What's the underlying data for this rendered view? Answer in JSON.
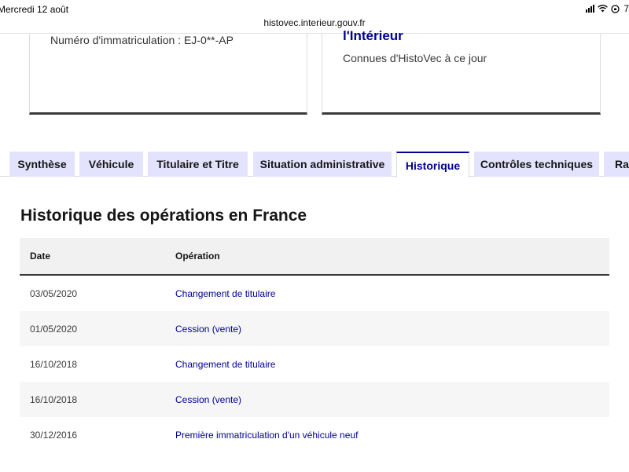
{
  "statusbar": {
    "time": "Mercredi 12 août",
    "battery": "7"
  },
  "browser": {
    "url": "histovec.interieur.gouv.fr"
  },
  "cards": {
    "left": {
      "plate_label": "Numéro d'immatriculation : EJ-0**-AP"
    },
    "right": {
      "title": "l'Intérieur",
      "subtitle": "Connues d'HistoVec à ce jour"
    }
  },
  "tabs": [
    {
      "label": "Synthèse"
    },
    {
      "label": "Véhicule"
    },
    {
      "label": "Titulaire et Titre"
    },
    {
      "label": "Situation administrative"
    },
    {
      "label": "Historique"
    },
    {
      "label": "Contrôles techniques"
    },
    {
      "label": "Rap"
    }
  ],
  "active_tab": "Historique",
  "history": {
    "title": "Historique des opérations en France",
    "columns": {
      "date": "Date",
      "operation": "Opération"
    },
    "rows": [
      {
        "date": "03/05/2020",
        "operation": "Changement de titulaire"
      },
      {
        "date": "01/05/2020",
        "operation": "Cession (vente)"
      },
      {
        "date": "16/10/2018",
        "operation": "Changement de titulaire"
      },
      {
        "date": "16/10/2018",
        "operation": "Cession (vente)"
      },
      {
        "date": "30/12/2016",
        "operation": "Première immatriculation d'un véhicule neuf"
      }
    ]
  },
  "colors": {
    "accent": "#000091",
    "tab_bg": "#e3e3fd",
    "row_alt": "#f6f6f6",
    "header_bg": "#f1f1f1"
  }
}
